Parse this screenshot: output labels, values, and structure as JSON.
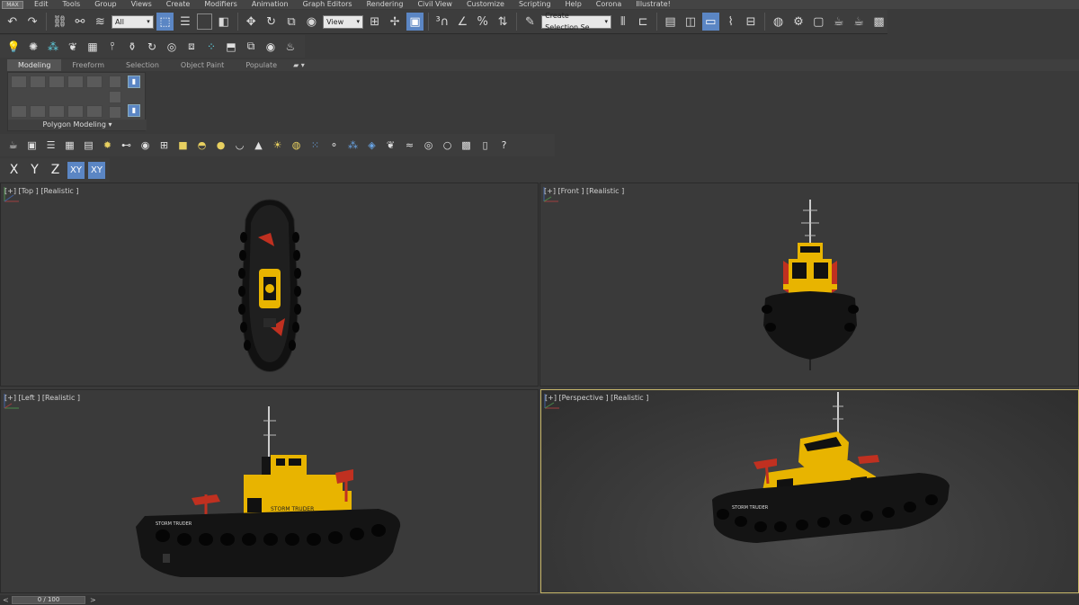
{
  "menu": {
    "logo": "MAX",
    "items": [
      "Edit",
      "Tools",
      "Group",
      "Views",
      "Create",
      "Modifiers",
      "Animation",
      "Graph Editors",
      "Rendering",
      "Civil View",
      "Customize",
      "Scripting",
      "Help",
      "Corona",
      "Illustrate!"
    ]
  },
  "toolbar": {
    "filter_select": "All",
    "view_select": "View",
    "selection_set_placeholder": "Create Selection Se"
  },
  "ribbon": {
    "tabs": [
      "Modeling",
      "Freeform",
      "Selection",
      "Object Paint",
      "Populate"
    ],
    "active_tab": "Modeling",
    "panel_label": "Polygon Modeling ▾"
  },
  "axes": [
    "X",
    "Y",
    "Z",
    "XY",
    "XY"
  ],
  "viewports": {
    "top": "[+] [Top ] [Realistic ]",
    "front": "[+] [Front ] [Realistic ]",
    "left": "[+] [Left ] [Realistic ]",
    "perspective": "[+] [Perspective ] [Realistic ]"
  },
  "boat_text": {
    "name": "STORM TRUDER",
    "name_left_hull": "STORM TRUDER",
    "bow_text": "STORM TRUDER"
  },
  "timeline": {
    "frame": "0 / 100",
    "prev": "<",
    "next": ">"
  },
  "colors": {
    "hull": "#141414",
    "yellow": "#e8b400",
    "red": "#c03020",
    "active_blue": "#5b86c4"
  }
}
